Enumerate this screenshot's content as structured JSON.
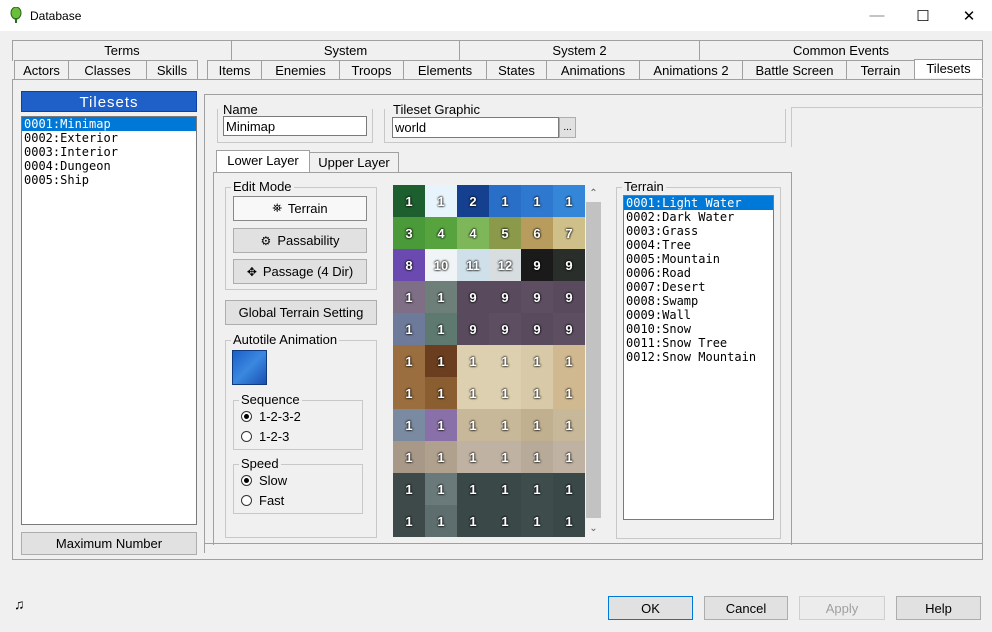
{
  "window": {
    "title": "Database",
    "minimize": "—",
    "maximize": "☐",
    "close": "✕"
  },
  "tabs_back": [
    "Terms",
    "System",
    "System 2",
    "Common Events"
  ],
  "tabs_front": [
    "Actors",
    "Classes",
    "Skills",
    "Items",
    "Enemies",
    "Troops",
    "Elements",
    "States",
    "Animations",
    "Animations 2",
    "Battle Screen",
    "Terrain",
    "Tilesets"
  ],
  "left": {
    "header": "Tilesets",
    "items": [
      "0001:Minimap",
      "0002:Exterior",
      "0003:Interior",
      "0004:Dungeon",
      "0005:Ship"
    ],
    "selected": 0,
    "max_button": "Maximum Number"
  },
  "name": {
    "label": "Name",
    "value": "Minimap"
  },
  "graphic": {
    "label": "Tileset Graphic",
    "value": "world",
    "browse": "..."
  },
  "layer_tabs": [
    "Lower Layer",
    "Upper Layer"
  ],
  "edit_mode": {
    "label": "Edit Mode",
    "buttons": [
      "Terrain",
      "Passability",
      "Passage (4 Dir)"
    ]
  },
  "global_terrain": "Global Terrain Setting",
  "autotile": {
    "label": "Autotile Animation",
    "sequence": {
      "label": "Sequence",
      "options": [
        "1-2-3-2",
        "1-2-3"
      ],
      "selected": 0
    },
    "speed": {
      "label": "Speed",
      "options": [
        "Slow",
        "Fast"
      ],
      "selected": 0
    }
  },
  "tiles": [
    {
      "n": "1",
      "c": "#1d5f2e"
    },
    {
      "n": "1",
      "c": "#e8f4fb"
    },
    {
      "n": "2",
      "c": "#14408f"
    },
    {
      "n": "1",
      "c": "#2a6fc7"
    },
    {
      "n": "1",
      "c": "#2f78cf"
    },
    {
      "n": "1",
      "c": "#3487d8"
    },
    {
      "n": "3",
      "c": "#4a9a3a"
    },
    {
      "n": "4",
      "c": "#57a43f"
    },
    {
      "n": "4",
      "c": "#7eb65a"
    },
    {
      "n": "5",
      "c": "#8a9a4a"
    },
    {
      "n": "6",
      "c": "#b89c5e"
    },
    {
      "n": "7",
      "c": "#cfc08a"
    },
    {
      "n": "8",
      "c": "#6a4ab0"
    },
    {
      "n": "10",
      "c": "#f0f4f6"
    },
    {
      "n": "11",
      "c": "#cfe0ea"
    },
    {
      "n": "12",
      "c": "#d8dde0"
    },
    {
      "n": "9",
      "c": "#1a1a1a"
    },
    {
      "n": "9",
      "c": "#2a2e2a"
    },
    {
      "n": "1",
      "c": "#7e6e86"
    },
    {
      "n": "1",
      "c": "#6e7e78"
    },
    {
      "n": "9",
      "c": "#5a4a5e"
    },
    {
      "n": "9",
      "c": "#5a4a5e"
    },
    {
      "n": "9",
      "c": "#5e4e62"
    },
    {
      "n": "9",
      "c": "#5a4a5e"
    },
    {
      "n": "1",
      "c": "#6e7a9a"
    },
    {
      "n": "1",
      "c": "#5e7a70"
    },
    {
      "n": "9",
      "c": "#5a4a5e"
    },
    {
      "n": "9",
      "c": "#5e4e62"
    },
    {
      "n": "9",
      "c": "#5a4a5e"
    },
    {
      "n": "9",
      "c": "#5e4e62"
    },
    {
      "n": "1",
      "c": "#9a6e3e"
    },
    {
      "n": "1",
      "c": "#6a3e1e"
    },
    {
      "n": "1",
      "c": "#ddd0b0"
    },
    {
      "n": "1",
      "c": "#ddd0b0"
    },
    {
      "n": "1",
      "c": "#d8caa8"
    },
    {
      "n": "1",
      "c": "#d0b890"
    },
    {
      "n": "1",
      "c": "#9a6e3e"
    },
    {
      "n": "1",
      "c": "#8a5e30"
    },
    {
      "n": "1",
      "c": "#ddd0b0"
    },
    {
      "n": "1",
      "c": "#ddd0b0"
    },
    {
      "n": "1",
      "c": "#d8caa8"
    },
    {
      "n": "1",
      "c": "#d0b890"
    },
    {
      "n": "1",
      "c": "#7a8aa0"
    },
    {
      "n": "1",
      "c": "#8a70a8"
    },
    {
      "n": "1",
      "c": "#c8b89a"
    },
    {
      "n": "1",
      "c": "#c8b89a"
    },
    {
      "n": "1",
      "c": "#c0b090"
    },
    {
      "n": "1",
      "c": "#c8b89a"
    },
    {
      "n": "1",
      "c": "#a89888"
    },
    {
      "n": "1",
      "c": "#b0a08e"
    },
    {
      "n": "1",
      "c": "#bfb2a2"
    },
    {
      "n": "1",
      "c": "#bfb2a2"
    },
    {
      "n": "1",
      "c": "#b8aa98"
    },
    {
      "n": "1",
      "c": "#bfb2a2"
    },
    {
      "n": "1",
      "c": "#3e4a4a"
    },
    {
      "n": "1",
      "c": "#6a7a7a"
    },
    {
      "n": "1",
      "c": "#3a4848"
    },
    {
      "n": "1",
      "c": "#3a4848"
    },
    {
      "n": "1",
      "c": "#3e4c4c"
    },
    {
      "n": "1",
      "c": "#3a4848"
    },
    {
      "n": "1",
      "c": "#3e4a4a"
    },
    {
      "n": "1",
      "c": "#5e6e6e"
    },
    {
      "n": "1",
      "c": "#3a4848"
    },
    {
      "n": "1",
      "c": "#3a4848"
    },
    {
      "n": "1",
      "c": "#3e4c4c"
    },
    {
      "n": "1",
      "c": "#3a4848"
    }
  ],
  "terrain": {
    "label": "Terrain",
    "items": [
      "0001:Light Water",
      "0002:Dark Water",
      "0003:Grass",
      "0004:Tree",
      "0005:Mountain",
      "0006:Road",
      "0007:Desert",
      "0008:Swamp",
      "0009:Wall",
      "0010:Snow",
      "0011:Snow Tree",
      "0012:Snow Mountain"
    ],
    "selected": 0
  },
  "footer": {
    "ok": "OK",
    "cancel": "Cancel",
    "apply": "Apply",
    "help": "Help",
    "music_icon": "♫"
  }
}
